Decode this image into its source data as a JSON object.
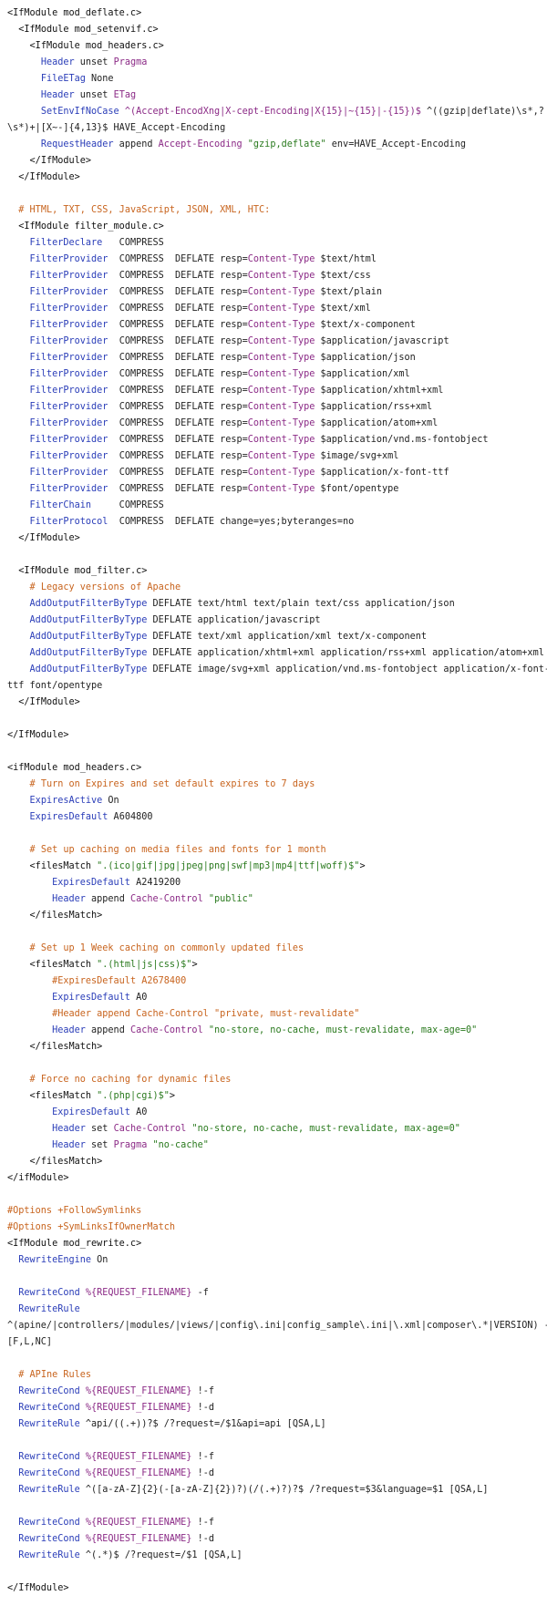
{
  "colors": {
    "plain": "#222222",
    "tag": "#111111",
    "directive": "#2a3db8",
    "string": "#2a7a1e",
    "comment": "#c8641e",
    "variable": "#8b2a86"
  },
  "lines": [
    [
      [
        "t",
        "<IfModule mod_deflate.c>"
      ]
    ],
    [
      [
        "p",
        "  "
      ],
      [
        "t",
        "<IfModule mod_setenvif.c>"
      ]
    ],
    [
      [
        "p",
        "    "
      ],
      [
        "t",
        "<IfModule mod_headers.c>"
      ]
    ],
    [
      [
        "p",
        "      "
      ],
      [
        "d",
        "Header"
      ],
      [
        "p",
        " unset "
      ],
      [
        "v",
        "Pragma"
      ]
    ],
    [
      [
        "p",
        "      "
      ],
      [
        "d",
        "FileETag"
      ],
      [
        "p",
        " None"
      ]
    ],
    [
      [
        "p",
        "      "
      ],
      [
        "d",
        "Header"
      ],
      [
        "p",
        " unset "
      ],
      [
        "v",
        "ETag"
      ]
    ],
    [
      [
        "p",
        "      "
      ],
      [
        "d",
        "SetEnvIfNoCase"
      ],
      [
        "p",
        " "
      ],
      [
        "v",
        "^(Accept-EncodXng|X-cept-Encoding|X{15}|~{15}|-{15})$"
      ],
      [
        "p",
        " ^((gzip|deflate)\\s*,?"
      ]
    ],
    [
      [
        "p",
        "\\s*)+|[X~-]{4,13}$ HAVE_Accept-Encoding"
      ]
    ],
    [
      [
        "p",
        "      "
      ],
      [
        "d",
        "RequestHeader"
      ],
      [
        "p",
        " append "
      ],
      [
        "v",
        "Accept-Encoding"
      ],
      [
        "p",
        " "
      ],
      [
        "s",
        "\"gzip,deflate\""
      ],
      [
        "p",
        " env=HAVE_Accept-Encoding"
      ]
    ],
    [
      [
        "p",
        "    "
      ],
      [
        "t",
        "</IfModule>"
      ]
    ],
    [
      [
        "p",
        "  "
      ],
      [
        "t",
        "</IfModule>"
      ]
    ],
    [
      [
        "p",
        ""
      ]
    ],
    [
      [
        "p",
        "  "
      ],
      [
        "c",
        "# HTML, TXT, CSS, JavaScript, JSON, XML, HTC:"
      ]
    ],
    [
      [
        "p",
        "  "
      ],
      [
        "t",
        "<IfModule filter_module.c>"
      ]
    ],
    [
      [
        "p",
        "    "
      ],
      [
        "d",
        "FilterDeclare"
      ],
      [
        "p",
        "   COMPRESS"
      ]
    ],
    [
      [
        "p",
        "    "
      ],
      [
        "d",
        "FilterProvider"
      ],
      [
        "p",
        "  COMPRESS  DEFLATE resp="
      ],
      [
        "v",
        "Content-Type"
      ],
      [
        "p",
        " $text/html"
      ]
    ],
    [
      [
        "p",
        "    "
      ],
      [
        "d",
        "FilterProvider"
      ],
      [
        "p",
        "  COMPRESS  DEFLATE resp="
      ],
      [
        "v",
        "Content-Type"
      ],
      [
        "p",
        " $text/css"
      ]
    ],
    [
      [
        "p",
        "    "
      ],
      [
        "d",
        "FilterProvider"
      ],
      [
        "p",
        "  COMPRESS  DEFLATE resp="
      ],
      [
        "v",
        "Content-Type"
      ],
      [
        "p",
        " $text/plain"
      ]
    ],
    [
      [
        "p",
        "    "
      ],
      [
        "d",
        "FilterProvider"
      ],
      [
        "p",
        "  COMPRESS  DEFLATE resp="
      ],
      [
        "v",
        "Content-Type"
      ],
      [
        "p",
        " $text/xml"
      ]
    ],
    [
      [
        "p",
        "    "
      ],
      [
        "d",
        "FilterProvider"
      ],
      [
        "p",
        "  COMPRESS  DEFLATE resp="
      ],
      [
        "v",
        "Content-Type"
      ],
      [
        "p",
        " $text/x-component"
      ]
    ],
    [
      [
        "p",
        "    "
      ],
      [
        "d",
        "FilterProvider"
      ],
      [
        "p",
        "  COMPRESS  DEFLATE resp="
      ],
      [
        "v",
        "Content-Type"
      ],
      [
        "p",
        " $application/javascript"
      ]
    ],
    [
      [
        "p",
        "    "
      ],
      [
        "d",
        "FilterProvider"
      ],
      [
        "p",
        "  COMPRESS  DEFLATE resp="
      ],
      [
        "v",
        "Content-Type"
      ],
      [
        "p",
        " $application/json"
      ]
    ],
    [
      [
        "p",
        "    "
      ],
      [
        "d",
        "FilterProvider"
      ],
      [
        "p",
        "  COMPRESS  DEFLATE resp="
      ],
      [
        "v",
        "Content-Type"
      ],
      [
        "p",
        " $application/xml"
      ]
    ],
    [
      [
        "p",
        "    "
      ],
      [
        "d",
        "FilterProvider"
      ],
      [
        "p",
        "  COMPRESS  DEFLATE resp="
      ],
      [
        "v",
        "Content-Type"
      ],
      [
        "p",
        " $application/xhtml+xml"
      ]
    ],
    [
      [
        "p",
        "    "
      ],
      [
        "d",
        "FilterProvider"
      ],
      [
        "p",
        "  COMPRESS  DEFLATE resp="
      ],
      [
        "v",
        "Content-Type"
      ],
      [
        "p",
        " $application/rss+xml"
      ]
    ],
    [
      [
        "p",
        "    "
      ],
      [
        "d",
        "FilterProvider"
      ],
      [
        "p",
        "  COMPRESS  DEFLATE resp="
      ],
      [
        "v",
        "Content-Type"
      ],
      [
        "p",
        " $application/atom+xml"
      ]
    ],
    [
      [
        "p",
        "    "
      ],
      [
        "d",
        "FilterProvider"
      ],
      [
        "p",
        "  COMPRESS  DEFLATE resp="
      ],
      [
        "v",
        "Content-Type"
      ],
      [
        "p",
        " $application/vnd.ms-fontobject"
      ]
    ],
    [
      [
        "p",
        "    "
      ],
      [
        "d",
        "FilterProvider"
      ],
      [
        "p",
        "  COMPRESS  DEFLATE resp="
      ],
      [
        "v",
        "Content-Type"
      ],
      [
        "p",
        " $image/svg+xml"
      ]
    ],
    [
      [
        "p",
        "    "
      ],
      [
        "d",
        "FilterProvider"
      ],
      [
        "p",
        "  COMPRESS  DEFLATE resp="
      ],
      [
        "v",
        "Content-Type"
      ],
      [
        "p",
        " $application/x-font-ttf"
      ]
    ],
    [
      [
        "p",
        "    "
      ],
      [
        "d",
        "FilterProvider"
      ],
      [
        "p",
        "  COMPRESS  DEFLATE resp="
      ],
      [
        "v",
        "Content-Type"
      ],
      [
        "p",
        " $font/opentype"
      ]
    ],
    [
      [
        "p",
        "    "
      ],
      [
        "d",
        "FilterChain"
      ],
      [
        "p",
        "     COMPRESS"
      ]
    ],
    [
      [
        "p",
        "    "
      ],
      [
        "d",
        "FilterProtocol"
      ],
      [
        "p",
        "  COMPRESS  DEFLATE change=yes;byteranges=no"
      ]
    ],
    [
      [
        "p",
        "  "
      ],
      [
        "t",
        "</IfModule>"
      ]
    ],
    [
      [
        "p",
        ""
      ]
    ],
    [
      [
        "p",
        "  "
      ],
      [
        "t",
        "<IfModule mod_filter.c>"
      ]
    ],
    [
      [
        "p",
        "    "
      ],
      [
        "c",
        "# Legacy versions of Apache"
      ]
    ],
    [
      [
        "p",
        "    "
      ],
      [
        "d",
        "AddOutputFilterByType"
      ],
      [
        "p",
        " DEFLATE text/html text/plain text/css application/json"
      ]
    ],
    [
      [
        "p",
        "    "
      ],
      [
        "d",
        "AddOutputFilterByType"
      ],
      [
        "p",
        " DEFLATE application/javascript"
      ]
    ],
    [
      [
        "p",
        "    "
      ],
      [
        "d",
        "AddOutputFilterByType"
      ],
      [
        "p",
        " DEFLATE text/xml application/xml text/x-component"
      ]
    ],
    [
      [
        "p",
        "    "
      ],
      [
        "d",
        "AddOutputFilterByType"
      ],
      [
        "p",
        " DEFLATE application/xhtml+xml application/rss+xml application/atom+xml"
      ]
    ],
    [
      [
        "p",
        "    "
      ],
      [
        "d",
        "AddOutputFilterByType"
      ],
      [
        "p",
        " DEFLATE image/svg+xml application/vnd.ms-fontobject application/x-font-"
      ]
    ],
    [
      [
        "p",
        "ttf font/opentype"
      ]
    ],
    [
      [
        "p",
        "  "
      ],
      [
        "t",
        "</IfModule>"
      ]
    ],
    [
      [
        "p",
        ""
      ]
    ],
    [
      [
        "t",
        "</IfModule>"
      ]
    ],
    [
      [
        "p",
        ""
      ]
    ],
    [
      [
        "t",
        "<ifModule mod_headers.c>"
      ]
    ],
    [
      [
        "p",
        "    "
      ],
      [
        "c",
        "# Turn on Expires and set default expires to 7 days"
      ]
    ],
    [
      [
        "p",
        "    "
      ],
      [
        "d",
        "ExpiresActive"
      ],
      [
        "p",
        " On"
      ]
    ],
    [
      [
        "p",
        "    "
      ],
      [
        "d",
        "ExpiresDefault"
      ],
      [
        "p",
        " A604800"
      ]
    ],
    [
      [
        "p",
        ""
      ]
    ],
    [
      [
        "p",
        "    "
      ],
      [
        "c",
        "# Set up caching on media files and fonts for 1 month"
      ]
    ],
    [
      [
        "p",
        "    "
      ],
      [
        "t",
        "<filesMatch"
      ],
      [
        "p",
        " "
      ],
      [
        "s",
        "\".(ico|gif|jpg|jpeg|png|swf|mp3|mp4|ttf|woff)$\""
      ],
      [
        "t",
        ">"
      ]
    ],
    [
      [
        "p",
        "        "
      ],
      [
        "d",
        "ExpiresDefault"
      ],
      [
        "p",
        " A2419200"
      ]
    ],
    [
      [
        "p",
        "        "
      ],
      [
        "d",
        "Header"
      ],
      [
        "p",
        " append "
      ],
      [
        "v",
        "Cache-Control"
      ],
      [
        "p",
        " "
      ],
      [
        "s",
        "\"public\""
      ]
    ],
    [
      [
        "p",
        "    "
      ],
      [
        "t",
        "</filesMatch>"
      ]
    ],
    [
      [
        "p",
        ""
      ]
    ],
    [
      [
        "p",
        "    "
      ],
      [
        "c",
        "# Set up 1 Week caching on commonly updated files"
      ]
    ],
    [
      [
        "p",
        "    "
      ],
      [
        "t",
        "<filesMatch"
      ],
      [
        "p",
        " "
      ],
      [
        "s",
        "\".(html|js|css)$\""
      ],
      [
        "t",
        ">"
      ]
    ],
    [
      [
        "p",
        "        "
      ],
      [
        "c",
        "#ExpiresDefault A2678400"
      ]
    ],
    [
      [
        "p",
        "        "
      ],
      [
        "d",
        "ExpiresDefault"
      ],
      [
        "p",
        " A0"
      ]
    ],
    [
      [
        "p",
        "        "
      ],
      [
        "c",
        "#Header append Cache-Control \"private, must-revalidate\""
      ]
    ],
    [
      [
        "p",
        "        "
      ],
      [
        "d",
        "Header"
      ],
      [
        "p",
        " append "
      ],
      [
        "v",
        "Cache-Control"
      ],
      [
        "p",
        " "
      ],
      [
        "s",
        "\"no-store, no-cache, must-revalidate, max-age=0\""
      ]
    ],
    [
      [
        "p",
        "    "
      ],
      [
        "t",
        "</filesMatch>"
      ]
    ],
    [
      [
        "p",
        ""
      ]
    ],
    [
      [
        "p",
        "    "
      ],
      [
        "c",
        "# Force no caching for dynamic files"
      ]
    ],
    [
      [
        "p",
        "    "
      ],
      [
        "t",
        "<filesMatch"
      ],
      [
        "p",
        " "
      ],
      [
        "s",
        "\".(php|cgi)$\""
      ],
      [
        "t",
        ">"
      ]
    ],
    [
      [
        "p",
        "        "
      ],
      [
        "d",
        "ExpiresDefault"
      ],
      [
        "p",
        " A0"
      ]
    ],
    [
      [
        "p",
        "        "
      ],
      [
        "d",
        "Header"
      ],
      [
        "p",
        " set "
      ],
      [
        "v",
        "Cache-Control"
      ],
      [
        "p",
        " "
      ],
      [
        "s",
        "\"no-store, no-cache, must-revalidate, max-age=0\""
      ]
    ],
    [
      [
        "p",
        "        "
      ],
      [
        "d",
        "Header"
      ],
      [
        "p",
        " set "
      ],
      [
        "v",
        "Pragma"
      ],
      [
        "p",
        " "
      ],
      [
        "s",
        "\"no-cache\""
      ]
    ],
    [
      [
        "p",
        "    "
      ],
      [
        "t",
        "</filesMatch>"
      ]
    ],
    [
      [
        "t",
        "</ifModule>"
      ]
    ],
    [
      [
        "p",
        ""
      ]
    ],
    [
      [
        "c",
        "#Options +FollowSymlinks"
      ]
    ],
    [
      [
        "c",
        "#Options +SymLinksIfOwnerMatch"
      ]
    ],
    [
      [
        "t",
        "<IfModule mod_rewrite.c>"
      ]
    ],
    [
      [
        "p",
        "  "
      ],
      [
        "d",
        "RewriteEngine"
      ],
      [
        "p",
        " On"
      ]
    ],
    [
      [
        "p",
        ""
      ]
    ],
    [
      [
        "p",
        "  "
      ],
      [
        "d",
        "RewriteCond"
      ],
      [
        "p",
        " "
      ],
      [
        "v",
        "%{REQUEST_FILENAME}"
      ],
      [
        "p",
        " -f"
      ]
    ],
    [
      [
        "p",
        "  "
      ],
      [
        "d",
        "RewriteRule"
      ]
    ],
    [
      [
        "p",
        "^(apine/|controllers/|modules/|views/|config\\.ini|config_sample\\.ini|\\.xml|composer\\.*|VERSION) -"
      ]
    ],
    [
      [
        "p",
        "[F,L,NC]"
      ]
    ],
    [
      [
        "p",
        ""
      ]
    ],
    [
      [
        "p",
        "  "
      ],
      [
        "c",
        "# APIne Rules"
      ]
    ],
    [
      [
        "p",
        "  "
      ],
      [
        "d",
        "RewriteCond"
      ],
      [
        "p",
        " "
      ],
      [
        "v",
        "%{REQUEST_FILENAME}"
      ],
      [
        "p",
        " !-f"
      ]
    ],
    [
      [
        "p",
        "  "
      ],
      [
        "d",
        "RewriteCond"
      ],
      [
        "p",
        " "
      ],
      [
        "v",
        "%{REQUEST_FILENAME}"
      ],
      [
        "p",
        " !-d"
      ]
    ],
    [
      [
        "p",
        "  "
      ],
      [
        "d",
        "RewriteRule"
      ],
      [
        "p",
        " ^api/((.+))?$ /?request=/$1&api=api [QSA,L]"
      ]
    ],
    [
      [
        "p",
        ""
      ]
    ],
    [
      [
        "p",
        "  "
      ],
      [
        "d",
        "RewriteCond"
      ],
      [
        "p",
        " "
      ],
      [
        "v",
        "%{REQUEST_FILENAME}"
      ],
      [
        "p",
        " !-f"
      ]
    ],
    [
      [
        "p",
        "  "
      ],
      [
        "d",
        "RewriteCond"
      ],
      [
        "p",
        " "
      ],
      [
        "v",
        "%{REQUEST_FILENAME}"
      ],
      [
        "p",
        " !-d"
      ]
    ],
    [
      [
        "p",
        "  "
      ],
      [
        "d",
        "RewriteRule"
      ],
      [
        "p",
        " ^([a-zA-Z]{2}(-[a-zA-Z]{2})?)(/(.+)?)?$ /?request=$3&language=$1 [QSA,L]"
      ]
    ],
    [
      [
        "p",
        ""
      ]
    ],
    [
      [
        "p",
        "  "
      ],
      [
        "d",
        "RewriteCond"
      ],
      [
        "p",
        " "
      ],
      [
        "v",
        "%{REQUEST_FILENAME}"
      ],
      [
        "p",
        " !-f"
      ]
    ],
    [
      [
        "p",
        "  "
      ],
      [
        "d",
        "RewriteCond"
      ],
      [
        "p",
        " "
      ],
      [
        "v",
        "%{REQUEST_FILENAME}"
      ],
      [
        "p",
        " !-d"
      ]
    ],
    [
      [
        "p",
        "  "
      ],
      [
        "d",
        "RewriteRule"
      ],
      [
        "p",
        " ^(.*)$ /?request=/$1 [QSA,L]"
      ]
    ],
    [
      [
        "p",
        ""
      ]
    ],
    [
      [
        "t",
        "</IfModule>"
      ]
    ]
  ]
}
